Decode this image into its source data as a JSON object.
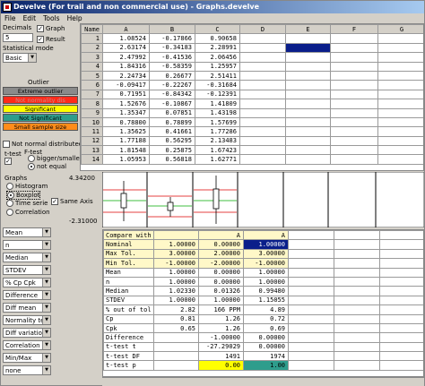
{
  "window": {
    "title": "Develve (For trail and non commercial use) - Graphs.develve"
  },
  "menu": [
    "File",
    "Edit",
    "Tools",
    "Help"
  ],
  "left": {
    "decimals_label": "Decimals",
    "decimals_value": "5",
    "graph_label": "Graph",
    "result_label": "Result",
    "stat_mode_label": "Statistical mode",
    "stat_mode_value": "Basic",
    "outlier_label": "Outlier",
    "legend": [
      {
        "text": "Extreme outlier",
        "color": "#8a8a8a"
      },
      {
        "text": "Not normality dis",
        "color": "#ff2a1a"
      },
      {
        "text": "Significant",
        "color": "#ffff00"
      },
      {
        "text": "Not Significant",
        "color": "#2e9d8c"
      },
      {
        "text": "Small sample size",
        "color": "#ff8c1a"
      }
    ],
    "not_normal_label": "Not normal distributed",
    "ttest_label": "t-test",
    "ftest_label": "F-test",
    "bigger_label": "bigger/smaller",
    "not_equal_label": "not equal"
  },
  "graphs": {
    "label": "Graphs",
    "options": [
      "Histogram",
      "Boxplot",
      "Time serie",
      "Correlation"
    ],
    "selected": "Boxplot",
    "same_axis_label": "Same Axis",
    "ymax": "4.34200",
    "ymin": "-2.31000"
  },
  "grid1": {
    "columns": [
      "Name",
      "A",
      "B",
      "C",
      "D",
      "E",
      "F",
      "G"
    ],
    "rows": [
      [
        "1",
        "1.08524",
        "-0.17866",
        "0.90658"
      ],
      [
        "2",
        "2.63174",
        "-0.34183",
        "2.28991"
      ],
      [
        "3",
        "2.47992",
        "-0.41536",
        "2.06456"
      ],
      [
        "4",
        "1.84316",
        "-0.58359",
        "1.25957"
      ],
      [
        "5",
        "2.24734",
        "0.26677",
        "2.51411"
      ],
      [
        "6",
        "-0.09417",
        "-0.22267",
        "-0.31684"
      ],
      [
        "7",
        "0.71951",
        "-0.84342",
        "-0.12391"
      ],
      [
        "8",
        "1.52676",
        "-0.10867",
        "1.41809"
      ],
      [
        "9",
        "1.35347",
        "0.07851",
        "1.43198"
      ],
      [
        "10",
        "0.78800",
        "0.78899",
        "1.57699"
      ],
      [
        "11",
        "1.35625",
        "0.41661",
        "1.77286"
      ],
      [
        "12",
        "1.77188",
        "0.56295",
        "2.13483"
      ],
      [
        "13",
        "1.81548",
        "0.25875",
        "1.67423"
      ],
      [
        "14",
        "1.05953",
        "0.56818",
        "1.62771"
      ]
    ]
  },
  "grid2": {
    "header": [
      "Compare with",
      "",
      "A",
      "A"
    ],
    "rows": [
      [
        "Nominal",
        "1.00000",
        "0.00000",
        "1.00000"
      ],
      [
        "Max Tol.",
        "3.00000",
        "2.00000",
        "3.00000"
      ],
      [
        "Min Tol.",
        "-1.00000",
        "-2.00000",
        "-1.00000"
      ],
      [
        "Mean",
        "1.00000",
        "0.00000",
        "1.00000"
      ],
      [
        "n",
        "1.00000",
        "0.00000",
        "1.00000"
      ],
      [
        "Median",
        "1.02330",
        "0.01326",
        "0.99480"
      ],
      [
        "STDEV",
        "1.00000",
        "1.00000",
        "1.15055"
      ],
      [
        "% out of tol",
        "2.82",
        "166 PPM",
        "4.89"
      ],
      [
        "Cp",
        "0.81",
        "1.26",
        "0.72"
      ],
      [
        "Cpk",
        "0.65",
        "1.26",
        "0.69"
      ],
      [
        "Difference",
        "",
        "-1.00000",
        "0.00000"
      ],
      [
        "t-test t",
        "",
        "-27.29029",
        "0.00000"
      ],
      [
        "t-test DF",
        "",
        "1491",
        "1974"
      ],
      [
        "t-test p",
        "",
        "0.00",
        "1.00"
      ]
    ]
  },
  "left_combos": [
    "Mean",
    "n",
    "Median",
    "STDEV",
    "% Cp Cpk",
    "Difference",
    "Diff mean",
    "Normality test",
    "Diff variation",
    "Correlation",
    "Min/Max",
    "none"
  ]
}
